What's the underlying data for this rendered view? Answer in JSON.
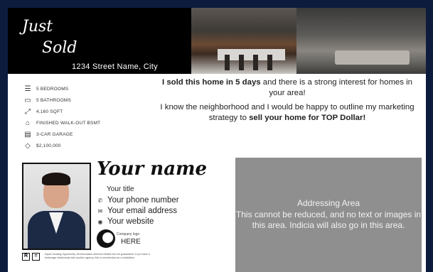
{
  "header": {
    "line1": "Just",
    "line2": "Sold",
    "address": "1234 Street Name, City"
  },
  "features": [
    {
      "icon": "bed-icon",
      "glyph": "☰",
      "label": "5 BEDROOMS"
    },
    {
      "icon": "bathtub-icon",
      "glyph": "▭",
      "label": "5 BATHROOMS"
    },
    {
      "icon": "measure-icon",
      "glyph": "⤢",
      "label": "4,160 SQFT"
    },
    {
      "icon": "basement-icon",
      "glyph": "⌂",
      "label": "FINISHED WALK-OUT BSMT"
    },
    {
      "icon": "garage-icon",
      "glyph": "▤",
      "label": "3-CAR GARAGE"
    },
    {
      "icon": "price-tag-icon",
      "glyph": "◇",
      "label": "$2,100,000"
    }
  ],
  "message": {
    "p1_bold": "I sold this home in 5 days",
    "p1_rest": " and there is a strong interest for homes in your area!",
    "p2_start": "I know the neighborhood and I would be happy to outline my marketing strategy to ",
    "p2_bold": "sell your home for TOP Dollar!"
  },
  "agent": {
    "name": "Your name",
    "title": "Your title",
    "phone": "Your phone number",
    "email": "Your email address",
    "website": "Your website",
    "company_logo_label": "Company logo",
    "company_logo_here": "HERE"
  },
  "legal": {
    "logo1": "R",
    "logo2": "=",
    "disclaimer": "Equal Housing Opportunity. All information deemed reliable but not guaranteed. If you have a brokerage relationship with another agency, this is not intended as a solicitation."
  },
  "addressing": {
    "line1": "Addressing Area",
    "line2": "This cannot be reduced, and no text or images in this area. Indicia will also go in this area."
  }
}
